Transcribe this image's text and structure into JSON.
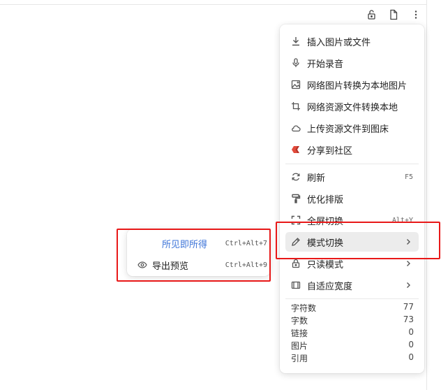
{
  "toolbar": {
    "icons": [
      "unlock-icon",
      "file-icon",
      "more-vertical-icon"
    ]
  },
  "menu": {
    "items": [
      {
        "label": "插入图片或文件",
        "icon": "download-icon"
      },
      {
        "label": "开始录音",
        "icon": "microphone-icon"
      },
      {
        "label": "网络图片转换为本地图片",
        "icon": "image-icon"
      },
      {
        "label": "网络资源文件转换本地",
        "icon": "crop-icon"
      },
      {
        "label": "上传资源文件到图床",
        "icon": "cloud-icon"
      },
      {
        "label": "分享到社区",
        "icon": "share-logo-icon"
      },
      {
        "label": "刷新",
        "icon": "refresh-icon",
        "shortcut": "F5"
      },
      {
        "label": "优化排版",
        "icon": "paint-roller-icon"
      },
      {
        "label": "全屏切换",
        "icon": "fullscreen-icon",
        "shortcut": "Alt+Y"
      },
      {
        "label": "模式切换",
        "icon": "pencil-icon"
      },
      {
        "label": "只读模式",
        "icon": "lock-icon"
      },
      {
        "label": "自适应宽度",
        "icon": "width-icon"
      }
    ],
    "stats": [
      {
        "label": "字符数",
        "value": "77"
      },
      {
        "label": "字数",
        "value": "73"
      },
      {
        "label": "链接",
        "value": "0"
      },
      {
        "label": "图片",
        "value": "0"
      },
      {
        "label": "引用",
        "value": "0"
      }
    ]
  },
  "submenu": {
    "items": [
      {
        "label": "所见即所得",
        "shortcut": "Ctrl+Alt+7",
        "selected": true
      },
      {
        "label": "导出预览",
        "shortcut": "Ctrl+Alt+9",
        "icon": "eye-icon"
      }
    ]
  },
  "colors": {
    "highlight": "#e81818",
    "selected_text": "#3b73d8",
    "active_bg": "#ececec"
  }
}
